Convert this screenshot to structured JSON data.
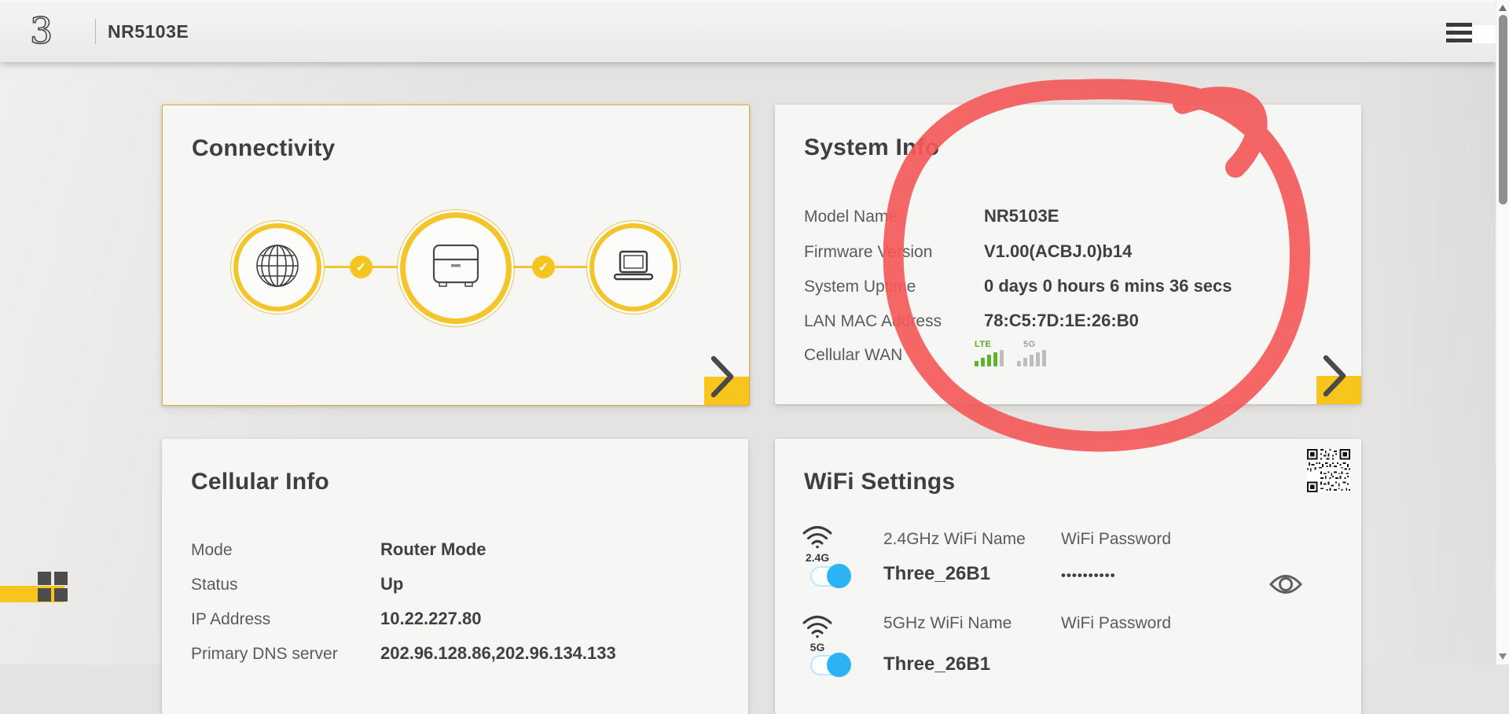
{
  "header": {
    "logo_text": "3",
    "title": "NR5103E"
  },
  "icons": {
    "check": "✓"
  },
  "cards": {
    "connectivity": {
      "title": "Connectivity"
    },
    "system_info": {
      "title": "System Info",
      "rows": [
        {
          "label": "Model Name",
          "value": "NR5103E"
        },
        {
          "label": "Firmware Version",
          "value": "V1.00(ACBJ.0)b14"
        },
        {
          "label": "System Uptime",
          "value": "0 days 0 hours 6 mins 36 secs"
        },
        {
          "label": "LAN MAC Address",
          "value": "78:C5:7D:1E:26:B0"
        }
      ],
      "cellular_wan_label": "Cellular WAN",
      "signal": {
        "lte_label": "LTE",
        "fiveg_label": "5G"
      }
    },
    "cellular_info": {
      "title": "Cellular Info",
      "rows": [
        {
          "label": "Mode",
          "value": "Router Mode"
        },
        {
          "label": "Status",
          "value": "Up"
        },
        {
          "label": "IP Address",
          "value": "10.22.227.80"
        },
        {
          "label": "Primary DNS server",
          "value": "202.96.128.86,202.96.134.133"
        }
      ]
    },
    "wifi_settings": {
      "title": "WiFi Settings",
      "bands": [
        {
          "band_label": "2.4G",
          "name_label": "2.4GHz WiFi Name",
          "password_label": "WiFi Password",
          "ssid": "Three_26B1",
          "password_mask": "••••••••••"
        },
        {
          "band_label": "5G",
          "name_label": "5GHz WiFi Name",
          "password_label": "WiFi Password",
          "ssid": "Three_26B1"
        }
      ]
    }
  },
  "colors": {
    "accent_yellow": "#f7c51c",
    "toggle_blue": "#2cb3f4",
    "signal_green": "#5bb62e",
    "annotation_red": "#f4595a"
  }
}
